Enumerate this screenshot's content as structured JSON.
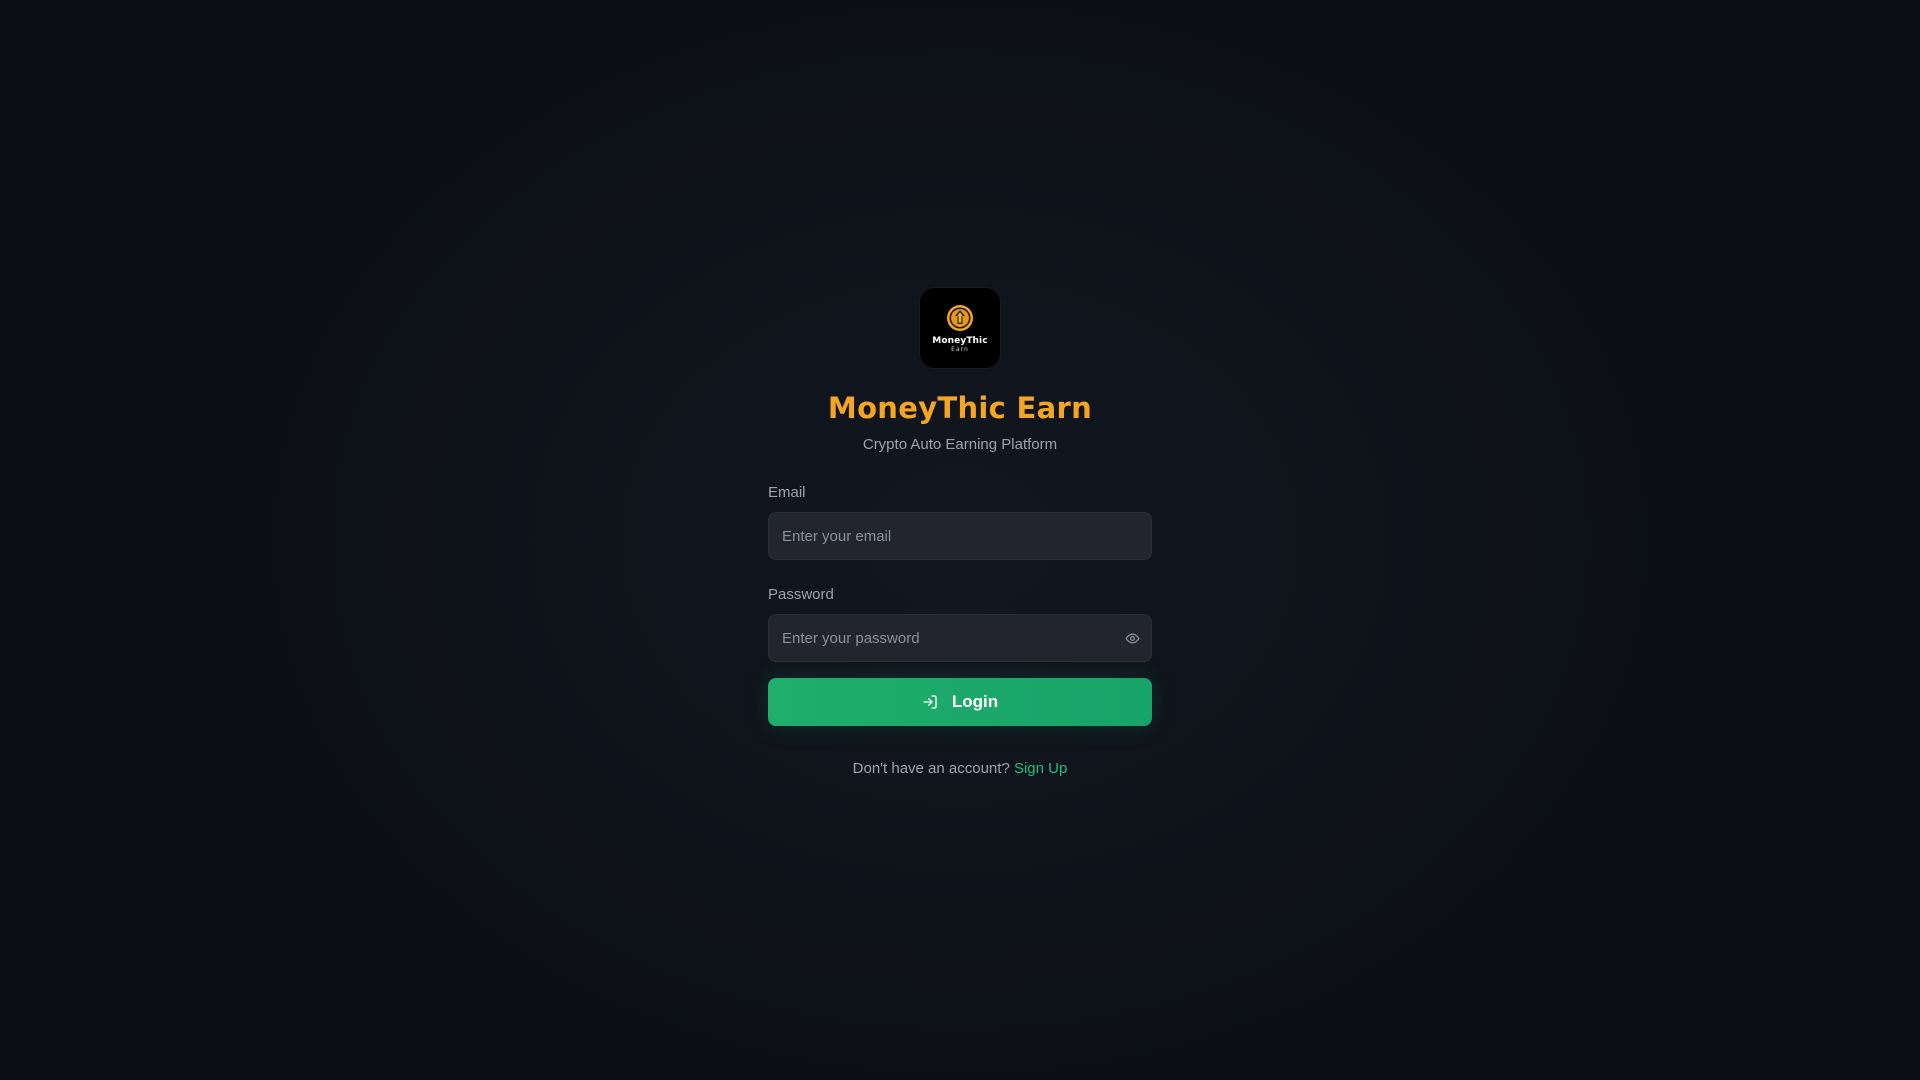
{
  "brand": {
    "logo_name": "MoneyThic",
    "logo_sub": "Earn",
    "title": "MoneyThic Earn",
    "subtitle": "Crypto Auto Earning Platform"
  },
  "form": {
    "email": {
      "label": "Email",
      "placeholder": "Enter your email",
      "value": ""
    },
    "password": {
      "label": "Password",
      "placeholder": "Enter your password",
      "value": "",
      "toggle_icon": "eye-icon"
    },
    "submit": {
      "label": "Login",
      "icon": "login-icon"
    }
  },
  "footer": {
    "prompt": "Don't have an account?",
    "link_label": "Sign Up"
  },
  "colors": {
    "brand_accent": "#f5a524",
    "primary_button": "#1fae6d",
    "link": "#22c07a",
    "background": "#0e1219",
    "input_bg": "#22252e"
  }
}
